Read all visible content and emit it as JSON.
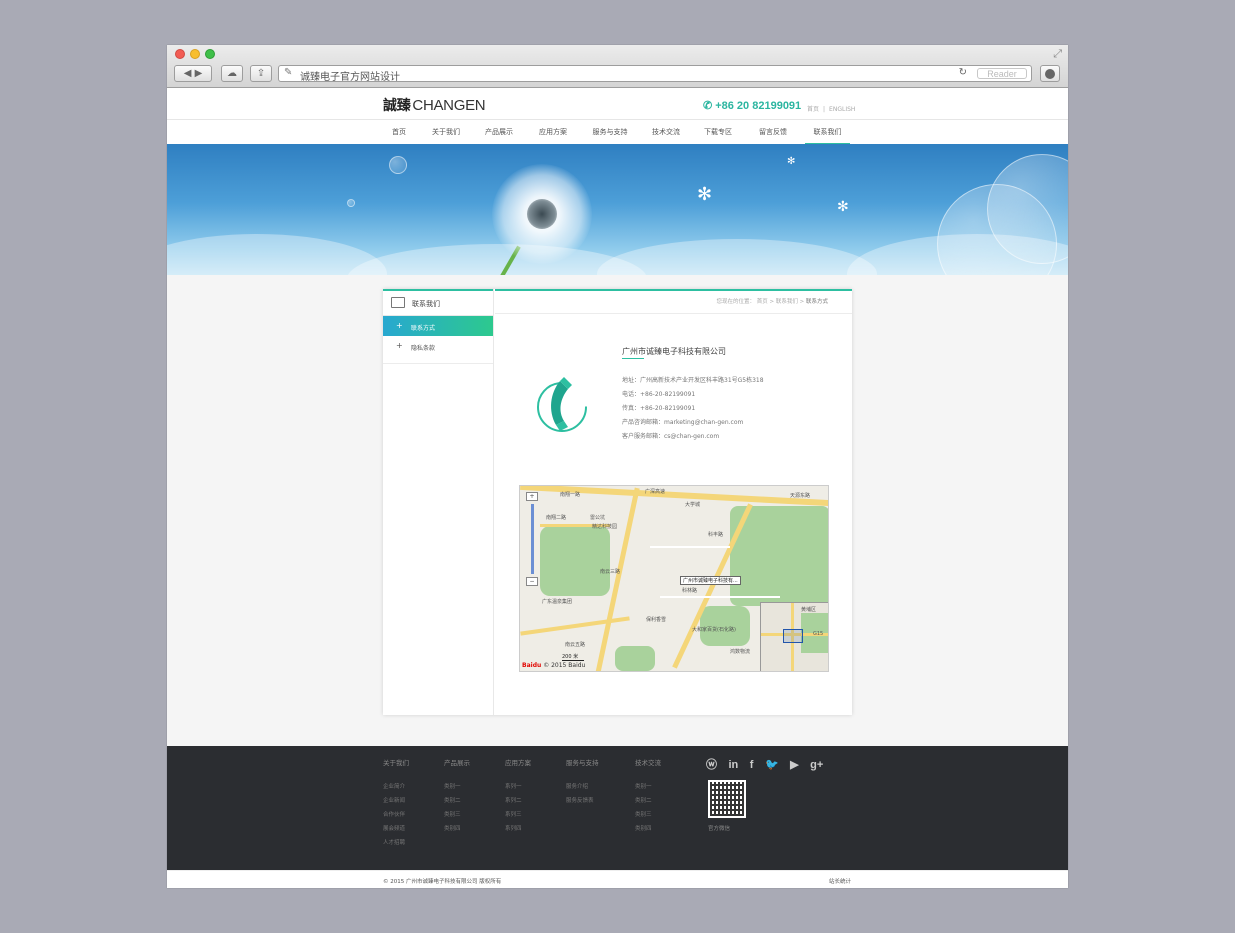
{
  "browser": {
    "address_text": "诚臻电子官方网站设计",
    "reader_label": "Reader"
  },
  "header": {
    "logo_cn": "誠臻",
    "logo_en": "CHANGEN",
    "phone": "+86 20 82199091",
    "lang_cn": "首页",
    "lang_sep": "|",
    "lang_en": "ENGLISH"
  },
  "nav": {
    "items": [
      {
        "label": "首页"
      },
      {
        "label": "关于我们"
      },
      {
        "label": "产品展示"
      },
      {
        "label": "应用方案"
      },
      {
        "label": "服务与支持"
      },
      {
        "label": "技术交流"
      },
      {
        "label": "下载专区"
      },
      {
        "label": "留言反馈"
      },
      {
        "label": "联系我们"
      }
    ],
    "active_index": 8
  },
  "sidebar": {
    "title": "联系我们",
    "items": [
      {
        "label": "联系方式",
        "icon": "plus"
      },
      {
        "label": "隐私条款",
        "icon": "plus"
      }
    ]
  },
  "breadcrumb": {
    "prefix": "您现在的位置：",
    "home": "首页",
    "sep": ">",
    "section": "联系我们",
    "current": "联系方式"
  },
  "contact": {
    "company": "广州市诚臻电子科技有限公司",
    "address": "地址：广州高新技术产业开发区科丰路31号G5栋318",
    "tel": "电话：+86-20-82199091",
    "fax": "传真：+86-20-82199091",
    "sales_email": "产品咨询邮箱：marketing@chan-gen.com",
    "service_email": "客户服务邮箱：cs@chan-gen.com"
  },
  "map": {
    "labels": {
      "road_top": "广深高速",
      "road_right": "天源东路",
      "road_left": "南翔二路",
      "road_nanxiang": "南翔一路",
      "road_nanyun": "南云三路",
      "road_nanyun2": "南云五路",
      "road_kefeng": "科丰路",
      "poi_daxue": "大学城",
      "poi_leigong": "雷公坑",
      "poi_jingda": "精达科技园",
      "poi_company_tag": "广州市诚臻电子科技有...",
      "poi_kelin": "科林路",
      "poi_guangdong": "广东温泉集团",
      "poi_baoli": "保利香雪",
      "poi_mall": "大和家百货(石化路)",
      "poi_hongxing": "鸿数物流",
      "poi_scale": "200 米",
      "poi_huang": "黄埔区",
      "poi_g15": "G15",
      "baidu": "Bai",
      "baidu_du": "du",
      "baidu_copy": "© 2015 Baidu"
    }
  },
  "footer": {
    "columns": [
      {
        "head": "关于我们",
        "links": [
          "企业简介",
          "企业新闻",
          "合作伙伴",
          "展会频道",
          "人才招聘"
        ]
      },
      {
        "head": "产品展示",
        "links": [
          "类别一",
          "类别二",
          "类别三",
          "类别四"
        ]
      },
      {
        "head": "应用方案",
        "links": [
          "系列一",
          "系列二",
          "系列三",
          "系列四"
        ]
      },
      {
        "head": "服务与支持",
        "links": [
          "服务介绍",
          "服务反馈表"
        ]
      },
      {
        "head": "技术交流",
        "links": [
          "类别一",
          "类别二",
          "类别三",
          "类别四"
        ]
      }
    ],
    "social": {
      "weibo": "ⓦ",
      "linkedin": "in",
      "facebook": "f",
      "twitter": "🐦",
      "youtube": "▶",
      "googleplus": "g+"
    },
    "qr_label": "官方微信",
    "copyright": "© 2015 广州市诚臻电子科技有限公司 版权所有",
    "stats": "站长统计"
  },
  "colors": {
    "accent": "#2dbfa1",
    "footer_bg": "#2b2d31"
  }
}
